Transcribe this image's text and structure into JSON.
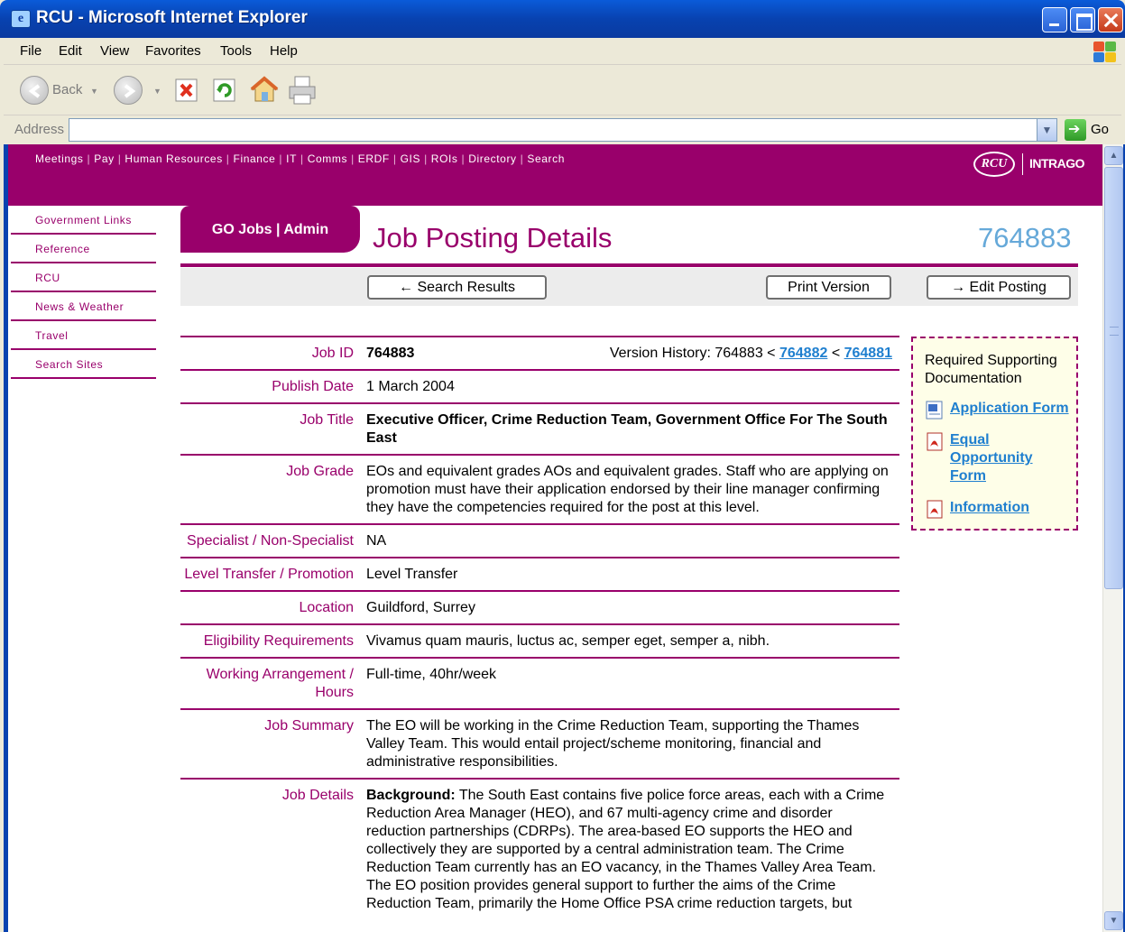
{
  "window": {
    "title": "RCU - Microsoft Internet Explorer"
  },
  "menu": {
    "items": [
      "File",
      "Edit",
      "View",
      "Favorites",
      "Tools",
      "Help"
    ]
  },
  "toolbar": {
    "back_label": "Back"
  },
  "address": {
    "label": "Address",
    "value": "",
    "go_label": "Go"
  },
  "site": {
    "top_nav": [
      "Meetings",
      "Pay",
      "Human Resources",
      "Finance",
      "IT",
      "Comms",
      "ERDF",
      "GIS",
      "ROIs",
      "Directory",
      "Search"
    ],
    "logo": {
      "left": "RCU",
      "right": "INTRAGO"
    },
    "side_nav": [
      "Government Links",
      "Reference",
      "RCU",
      "News & Weather",
      "Travel",
      "Search Sites"
    ]
  },
  "page": {
    "tab": "GO Jobs | Admin",
    "title": "Job Posting Details",
    "job_number": "764883",
    "buttons": {
      "search_results": "← Search Results",
      "print": "Print Version",
      "edit": "→ Edit Posting"
    }
  },
  "fields": {
    "job_id": {
      "label": "Job ID",
      "value": "764883"
    },
    "version_history": {
      "label": "Version History: 764883 <",
      "link1": "764882",
      "sep": "<",
      "link2": "764881"
    },
    "publish_date": {
      "label": "Publish Date",
      "value": "1 March 2004"
    },
    "job_title": {
      "label": "Job Title",
      "value": "Executive Officer, Crime Reduction Team, Government Office For The South East"
    },
    "job_grade": {
      "label": "Job Grade",
      "value": "EOs and equivalent grades AOs and equivalent grades. Staff who are applying on promotion must have their application endorsed by their line manager confirming they have the competencies required for the post at this level."
    },
    "specialist": {
      "label": "Specialist / Non-Specialist",
      "value": "NA"
    },
    "level_transfer": {
      "label": "Level Transfer / Promotion",
      "value": "Level Transfer"
    },
    "location": {
      "label": "Location",
      "value": "Guildford, Surrey"
    },
    "eligibility": {
      "label": "Eligibility Requirements",
      "value": "Vivamus quam mauris, luctus ac, semper eget, semper a, nibh."
    },
    "working": {
      "label": "Working Arrangement / Hours",
      "value": "Full-time, 40hr/week"
    },
    "summary": {
      "label": "Job Summary",
      "value": "The EO will be working in the Crime Reduction Team, supporting the Thames Valley Team. This would entail project/scheme monitoring, financial and administrative responsibilities."
    },
    "details": {
      "label": "Job Details",
      "lead": "Background:",
      "value": " The South East contains five police force areas, each with a Crime Reduction Area Manager (HEO), and 67 multi-agency crime and disorder reduction partnerships (CDRPs). The area-based EO supports the HEO and collectively they are supported by a central administration team. The Crime Reduction Team currently has an EO vacancy, in the Thames Valley Area Team. The EO position provides general support to further the aims of the Crime Reduction Team, primarily the Home Office PSA crime reduction targets, but"
    }
  },
  "docs": {
    "heading": "Required Supporting Documentation",
    "items": [
      {
        "label": "Application Form",
        "icon": "word-doc-icon"
      },
      {
        "label": "Equal Opportunity Form",
        "icon": "pdf-icon"
      },
      {
        "label": "Information",
        "icon": "pdf-icon"
      }
    ]
  },
  "colors": {
    "brand": "#99006b",
    "link": "#1f7fcf",
    "id_blue": "#66a9d9"
  }
}
